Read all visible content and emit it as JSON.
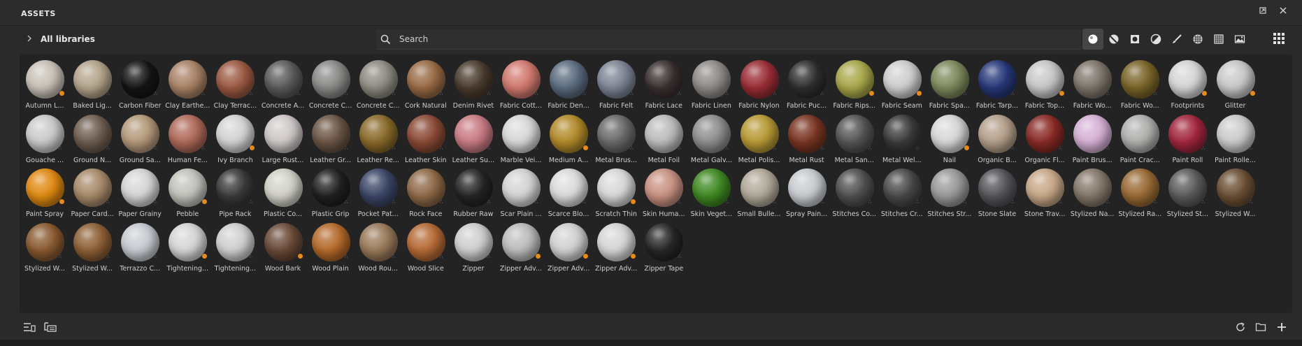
{
  "panel": {
    "title": "ASSETS"
  },
  "toolbar": {
    "libraries_label": "All libraries",
    "search_placeholder": "Search",
    "filters": [
      {
        "name": "materials-filter-icon",
        "active": true
      },
      {
        "name": "smart-materials-filter-icon",
        "active": false
      },
      {
        "name": "masks-filter-icon",
        "active": false
      },
      {
        "name": "generators-filter-icon",
        "active": false
      },
      {
        "name": "brushes-filter-icon",
        "active": false
      },
      {
        "name": "textures-filter-icon",
        "active": false
      },
      {
        "name": "alphas-filter-icon",
        "active": false
      },
      {
        "name": "environments-filter-icon",
        "active": false
      }
    ]
  },
  "colors": {
    "accent_badge": "#e88a1a",
    "background": "#2a2a2a",
    "panel": "#232323"
  },
  "assets": [
    {
      "label": "Autumn L...",
      "color": "#c9c2b8"
    },
    {
      "label": "Baked Lig...",
      "color": "#b5a58c"
    },
    {
      "label": "Carbon Fiber",
      "color": "#151515"
    },
    {
      "label": "Clay Earthe...",
      "color": "#a98366"
    },
    {
      "label": "Clay Terrac...",
      "color": "#9d5a43"
    },
    {
      "label": "Concrete A...",
      "color": "#5b5b5d"
    },
    {
      "label": "Concrete C...",
      "color": "#8a8a88"
    },
    {
      "label": "Concrete C...",
      "color": "#8e8c82"
    },
    {
      "label": "Cork Natural",
      "color": "#9a6b45"
    },
    {
      "label": "Denim Rivet",
      "color": "#4b3c2e"
    },
    {
      "label": "Fabric Cott...",
      "color": "#d27a70"
    },
    {
      "label": "Fabric Den...",
      "color": "#5b6c80"
    },
    {
      "label": "Fabric Felt",
      "color": "#7d8596"
    },
    {
      "label": "Fabric Lace",
      "color": "#3a3030"
    },
    {
      "label": "Fabric Linen",
      "color": "#8f8b88"
    },
    {
      "label": "Fabric Nylon",
      "color": "#9a2d35"
    },
    {
      "label": "Fabric Puc...",
      "color": "#2e2e2e"
    },
    {
      "label": "Fabric Rips...",
      "color": "#a9a84a"
    },
    {
      "label": "Fabric Seam",
      "color": "#cfcfcf"
    },
    {
      "label": "Fabric Spa...",
      "color": "#7d8a5c"
    },
    {
      "label": "Fabric Tarp...",
      "color": "#27387a"
    },
    {
      "label": "Fabric Top...",
      "color": "#c8c8c8"
    },
    {
      "label": "Fabric Wo...",
      "color": "#7f766c"
    },
    {
      "label": "Fabric Wo...",
      "color": "#7a6528"
    },
    {
      "label": "Footprints",
      "color": "#d6d6d6"
    },
    {
      "label": "Glitter",
      "color": "#c9c9c9"
    },
    {
      "label": "Gouache ...",
      "color": "#cbcbcb"
    },
    {
      "label": "Ground N...",
      "color": "#6e5d50"
    },
    {
      "label": "Ground Sa...",
      "color": "#b59a7a"
    },
    {
      "label": "Human Fe...",
      "color": "#b06a5a"
    },
    {
      "label": "Ivy Branch",
      "color": "#d4d4d4"
    },
    {
      "label": "Large Rust...",
      "color": "#cfc8c8"
    },
    {
      "label": "Leather Gr...",
      "color": "#6b5545"
    },
    {
      "label": "Leather Re...",
      "color": "#8a6a2a"
    },
    {
      "label": "Leather Skin",
      "color": "#8b4a35"
    },
    {
      "label": "Leather Su...",
      "color": "#c97c84"
    },
    {
      "label": "Marble Vei...",
      "color": "#d9d9d9"
    },
    {
      "label": "Medium A...",
      "color": "#b28a2a"
    },
    {
      "label": "Metal Brus...",
      "color": "#6a6a6a"
    },
    {
      "label": "Metal Foil",
      "color": "#bdbdbd"
    },
    {
      "label": "Metal Galv...",
      "color": "#8f8f8f"
    },
    {
      "label": "Metal Polis...",
      "color": "#b89a35"
    },
    {
      "label": "Metal Rust",
      "color": "#7a3522"
    },
    {
      "label": "Metal San...",
      "color": "#555555"
    },
    {
      "label": "Metal Wel...",
      "color": "#3b3b3b"
    },
    {
      "label": "Nail",
      "color": "#d8d8d8"
    },
    {
      "label": "Organic B...",
      "color": "#b5a08a"
    },
    {
      "label": "Organic Fl...",
      "color": "#8a2a25"
    },
    {
      "label": "Paint Brus...",
      "color": "#d6b1d6"
    },
    {
      "label": "Paint Crac...",
      "color": "#b0b0ae"
    },
    {
      "label": "Paint Roll",
      "color": "#a3263d"
    },
    {
      "label": "Paint Rolle...",
      "color": "#cccccc"
    },
    {
      "label": "Paint Spray",
      "color": "#e08a12"
    },
    {
      "label": "Paper Card...",
      "color": "#a88b6a"
    },
    {
      "label": "Paper Grainy",
      "color": "#d6d6d6"
    },
    {
      "label": "Pebble",
      "color": "#c3c3bd"
    },
    {
      "label": "Pipe Rack",
      "color": "#3a3a3a"
    },
    {
      "label": "Plastic Co...",
      "color": "#d2d2c8"
    },
    {
      "label": "Plastic Grip",
      "color": "#202020"
    },
    {
      "label": "Pocket Pat...",
      "color": "#3c4768"
    },
    {
      "label": "Rock Face",
      "color": "#8f6a48"
    },
    {
      "label": "Rubber Raw",
      "color": "#252525"
    },
    {
      "label": "Scar Plain ...",
      "color": "#d4d4d4"
    },
    {
      "label": "Scarce Blo...",
      "color": "#dcdcdc"
    },
    {
      "label": "Scratch Thin",
      "color": "#d8d8d8"
    },
    {
      "label": "Skin Huma...",
      "color": "#c99282"
    },
    {
      "label": "Skin Veget...",
      "color": "#3f8a22"
    },
    {
      "label": "Small Bulle...",
      "color": "#b2aa9a"
    },
    {
      "label": "Spray Pain...",
      "color": "#c8ccd0"
    },
    {
      "label": "Stitches Co...",
      "color": "#505050"
    },
    {
      "label": "Stitches Cr...",
      "color": "#4a4a4a"
    },
    {
      "label": "Stitches Str...",
      "color": "#9a9a9a"
    },
    {
      "label": "Stone Slate",
      "color": "#54555a"
    },
    {
      "label": "Stone Trav...",
      "color": "#c8a888"
    },
    {
      "label": "Stylized Na...",
      "color": "#85786a"
    },
    {
      "label": "Stylized Ra...",
      "color": "#9a6a35"
    },
    {
      "label": "Stylized St...",
      "color": "#5c5c5c"
    },
    {
      "label": "Stylized W...",
      "color": "#6b5035"
    },
    {
      "label": "Stylized W...",
      "color": "#8a5a30"
    },
    {
      "label": "Stylized W...",
      "color": "#8e6035"
    },
    {
      "label": "Terrazzo C...",
      "color": "#c8ccd2"
    },
    {
      "label": "Tightening...",
      "color": "#d6d6d6"
    },
    {
      "label": "Tightening...",
      "color": "#d0d0d0"
    },
    {
      "label": "Wood Bark",
      "color": "#6a4a38"
    },
    {
      "label": "Wood Plain",
      "color": "#b56a2a"
    },
    {
      "label": "Wood Rou...",
      "color": "#9a7a5a"
    },
    {
      "label": "Wood Slice",
      "color": "#b66a35"
    },
    {
      "label": "Zipper",
      "color": "#cfcfcf"
    },
    {
      "label": "Zipper Adv...",
      "color": "#bdbdbd"
    },
    {
      "label": "Zipper Adv...",
      "color": "#d2d2d2"
    },
    {
      "label": "Zipper Adv...",
      "color": "#d6d6d6"
    },
    {
      "label": "Zipper Tape",
      "color": "#262626"
    }
  ]
}
